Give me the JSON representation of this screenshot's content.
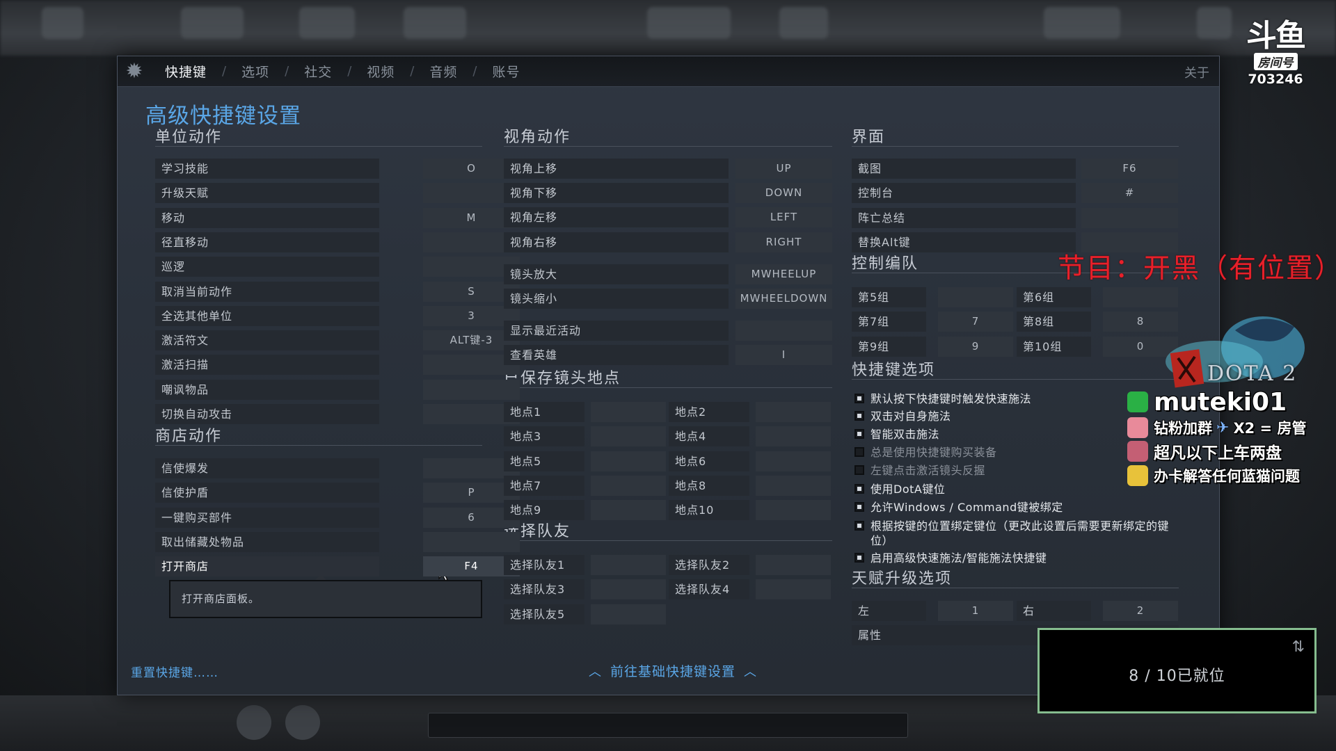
{
  "tabs": [
    {
      "label": "快捷键",
      "active": true
    },
    {
      "label": "选项"
    },
    {
      "label": "社交"
    },
    {
      "label": "视频"
    },
    {
      "label": "音频"
    },
    {
      "label": "账号"
    }
  ],
  "tab_separator": "/",
  "about_label": "关于",
  "page_title": "高级快捷键设置",
  "unit_actions": {
    "heading": "单位动作",
    "rows": [
      {
        "label": "学习技能",
        "key": "O"
      },
      {
        "label": "升级天赋",
        "key": ""
      },
      {
        "label": "移动",
        "key": "M"
      },
      {
        "label": "径直移动",
        "key": ""
      },
      {
        "label": "巡逻",
        "key": ""
      },
      {
        "label": "取消当前动作",
        "key": "S"
      },
      {
        "label": "全选其他单位",
        "key": "3"
      },
      {
        "label": "激活符文",
        "key": "ALT键-3"
      },
      {
        "label": "激活扫描",
        "key": ""
      },
      {
        "label": "嘲讽物品",
        "key": ""
      },
      {
        "label": "切换自动攻击",
        "key": ""
      }
    ]
  },
  "shop_actions": {
    "heading": "商店动作",
    "rows": [
      {
        "label": "信使爆发",
        "key": ""
      },
      {
        "label": "信使护盾",
        "key": "P"
      },
      {
        "label": "一键购买部件",
        "key": "6"
      },
      {
        "label": "取出储藏处物品",
        "key": ""
      },
      {
        "label": "打开商店",
        "key": "F4"
      }
    ],
    "tooltip": "打开商店面板。"
  },
  "camera_actions": {
    "heading": "视角动作",
    "rows": [
      {
        "label": "视角上移",
        "key": "UP"
      },
      {
        "label": "视角下移",
        "key": "DOWN"
      },
      {
        "label": "视角左移",
        "key": "LEFT"
      },
      {
        "label": "视角右移",
        "key": "RIGHT"
      },
      {
        "label": "镜头放大",
        "key": "MWHEELUP"
      },
      {
        "label": "镜头缩小",
        "key": "MWHEELDOWN"
      },
      {
        "label": "显示最近活动",
        "key": ""
      },
      {
        "label": "查看英雄",
        "key": "I"
      }
    ]
  },
  "saved_camera": {
    "heading": "已保存镜头地点",
    "cells": [
      {
        "label": "地点1",
        "key": ""
      },
      {
        "label": "地点2",
        "key": ""
      },
      {
        "label": "地点3",
        "key": ""
      },
      {
        "label": "地点4",
        "key": ""
      },
      {
        "label": "地点5",
        "key": ""
      },
      {
        "label": "地点6",
        "key": ""
      },
      {
        "label": "地点7",
        "key": ""
      },
      {
        "label": "地点8",
        "key": ""
      },
      {
        "label": "地点9",
        "key": ""
      },
      {
        "label": "地点10",
        "key": ""
      }
    ]
  },
  "select_ally": {
    "heading": "选择队友",
    "cells": [
      {
        "label": "选择队友1",
        "key": ""
      },
      {
        "label": "选择队友2",
        "key": ""
      },
      {
        "label": "选择队友3",
        "key": ""
      },
      {
        "label": "选择队友4",
        "key": ""
      },
      {
        "label": "选择队友5",
        "key": ""
      }
    ]
  },
  "interface": {
    "heading": "界面",
    "rows": [
      {
        "label": "截图",
        "key": "F6"
      },
      {
        "label": "控制台",
        "key": "#"
      },
      {
        "label": "阵亡总结",
        "key": ""
      },
      {
        "label": "替换Alt键",
        "key": ""
      }
    ]
  },
  "control_groups": {
    "heading": "控制编队",
    "cells": [
      {
        "label": "第5组",
        "key": ""
      },
      {
        "label": "第6组",
        "key": ""
      },
      {
        "label": "第7组",
        "key": "7"
      },
      {
        "label": "第8组",
        "key": "8"
      },
      {
        "label": "第9组",
        "key": "9"
      },
      {
        "label": "第10组",
        "key": "0"
      }
    ]
  },
  "hotkey_options": {
    "heading": "快捷键选项",
    "items": [
      {
        "text": "默认按下快捷键时触发快速施法",
        "checked": true
      },
      {
        "text": "双击对自身施法",
        "checked": true
      },
      {
        "text": "智能双击施法",
        "checked": true
      },
      {
        "text": "总是使用快捷键购买装备",
        "checked": false
      },
      {
        "text": "左键点击激活镜头反握",
        "checked": false
      },
      {
        "text": "使用DotA键位",
        "checked": true
      },
      {
        "text": "允许Windows / Command键被绑定",
        "checked": true
      },
      {
        "text": "根据按键的位置绑定键位（更改此设置后需要更新绑定的键位）",
        "checked": true
      },
      {
        "text": "启用高级快速施法/智能施法快捷键",
        "checked": true
      }
    ]
  },
  "talent_options": {
    "heading": "天赋升级选项",
    "cells": [
      {
        "label": "左",
        "key": "1"
      },
      {
        "label": "右",
        "key": "2"
      }
    ],
    "attribute_label": "属性"
  },
  "reset_link": "重置快捷键……",
  "goto_basic": "前往基础快捷键设置",
  "overlay": {
    "douyu_logo": "斗鱼",
    "room_label": "房间号",
    "room_number": "703246",
    "program": "节目：开黑（有位置）",
    "dota_text": "DOTA 2",
    "streamer_id": "muteki01",
    "promo_lines": [
      "钻粉加群",
      "X2 = 房管",
      "超凡以下上车两盘",
      "办卡解答任何蓝猫问题"
    ],
    "ready_status": "8 / 10已就位"
  },
  "colors": {
    "accent_blue": "#5aa6e6",
    "program_red": "#e8202a",
    "ready_border": "#86bd8f"
  }
}
